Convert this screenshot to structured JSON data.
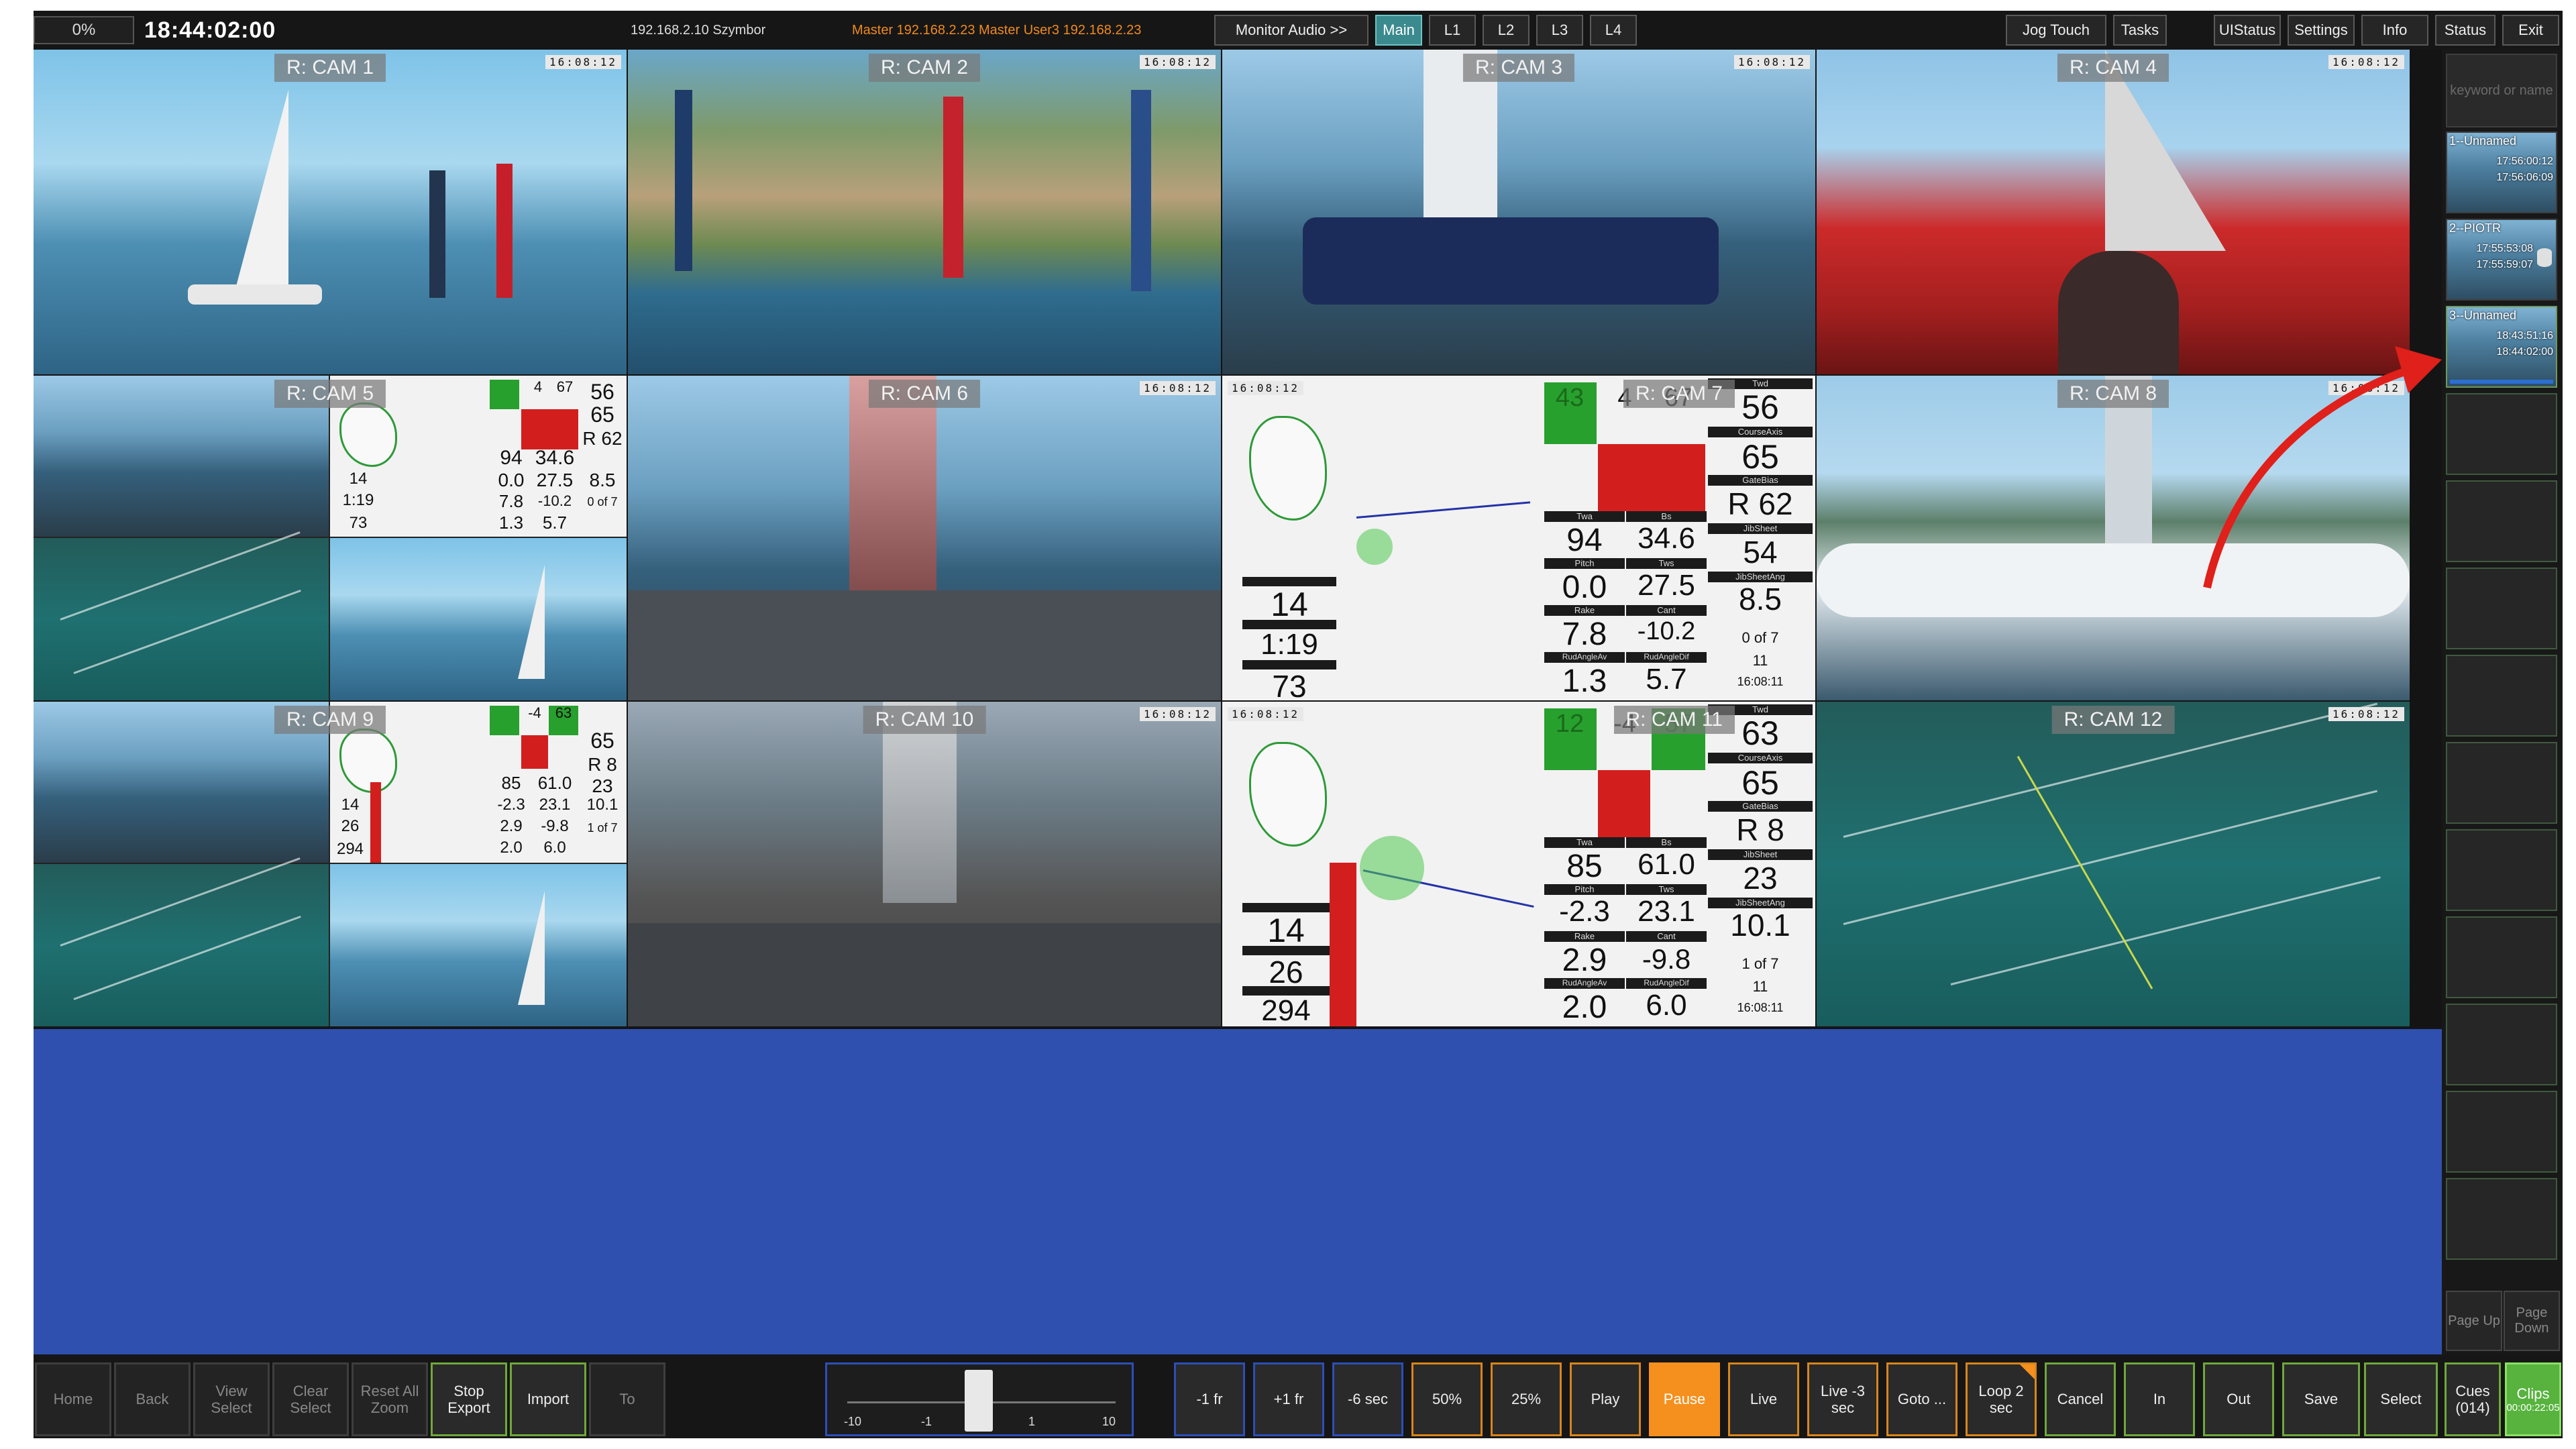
{
  "topbar": {
    "percent": "0%",
    "clock": "18:44:02:00",
    "ip_info": "192.168.2.10 Szymbor",
    "master_info": "Master 192.168.2.23   Master   User3   192.168.2.23",
    "buttons": {
      "monitor_audio": "Monitor Audio >>",
      "main": "Main",
      "l1": "L1",
      "l2": "L2",
      "l3": "L3",
      "l4": "L4",
      "jog_touch": "Jog Touch",
      "tasks": "Tasks",
      "uistatus": "UIStatus",
      "settings": "Settings",
      "info": "Info",
      "status": "Status",
      "exit": "Exit"
    }
  },
  "cams": [
    {
      "label": "R: CAM 1",
      "tc": "16:08:12"
    },
    {
      "label": "R: CAM 2",
      "tc": "16:08:12"
    },
    {
      "label": "R: CAM 3",
      "tc": "16:08:12"
    },
    {
      "label": "R: CAM 4",
      "tc": "16:08:12"
    },
    {
      "label": "R: CAM 5"
    },
    {
      "label": "R: CAM 6",
      "tc": "16:08:12"
    },
    {
      "label": "R: CAM 7",
      "tc": "16:08:12"
    },
    {
      "label": "R: CAM 8",
      "tc": "16:08:12"
    },
    {
      "label": "R: CAM 9"
    },
    {
      "label": "R: CAM 10",
      "tc": "16:08:12"
    },
    {
      "label": "R: CAM 11",
      "tc": "16:08:12"
    },
    {
      "label": "R: CAM 12",
      "tc": "16:08:12"
    }
  ],
  "telemetry_7": {
    "top": [
      "43",
      "4",
      "67"
    ],
    "twd_label": "Twd",
    "twd": "56",
    "courseaxis_label": "CourseAxis",
    "courseaxis": "65",
    "gatebias_label": "GateBias",
    "gatebias": "R 62",
    "jibsheet_label": "JibSheet",
    "jibsheet": "54",
    "jibsheetang_label": "JibSheetAng",
    "jibsheetang": "8.5",
    "twa_label": "Twa",
    "twa": "94",
    "bs_label": "Bs",
    "bs": "34.6",
    "pitch_label": "Pitch",
    "pitch": "0.0",
    "tws_label": "Tws",
    "tws": "27.5",
    "rake_label": "Rake",
    "rake": "7.8",
    "cant_label": "Cant",
    "cant": "-10.2",
    "rudangleav_label": "RudAngleAv",
    "rudangleav": "1.3",
    "rudangledif_label": "RudAngleDif",
    "rudangledif": "5.7",
    "count": "0 of 7",
    "small": "11",
    "time": "16:08:11",
    "left": [
      "14",
      "1:19",
      "73"
    ]
  },
  "telemetry_11": {
    "top": [
      "12",
      "-4",
      "57"
    ],
    "twd_label": "Twd",
    "twd": "63",
    "courseaxis_label": "CourseAxis",
    "courseaxis": "65",
    "gatebias_label": "GateBias",
    "gatebias": "R 8",
    "jibsheet_label": "JibSheet",
    "jibsheet": "23",
    "jibsheetang_label": "JibSheetAng",
    "jibsheetang": "10.1",
    "twa_label": "Twa",
    "twa": "85",
    "bs_label": "Bs",
    "bs": "61.0",
    "pitch_label": "Pitch",
    "pitch": "-2.3",
    "tws_label": "Tws",
    "tws": "23.1",
    "rake_label": "Rake",
    "rake": "2.9",
    "cant_label": "Cant",
    "cant": "-9.8",
    "rudangleav_label": "RudAngleAv",
    "rudangleav": "2.0",
    "rudangledif_label": "RudAngleDif",
    "rudangledif": "6.0",
    "count": "1 of 7",
    "small": "11",
    "time": "16:08:11",
    "left": [
      "14",
      "26",
      "294"
    ]
  },
  "telemetry_5": {
    "top": [
      "4",
      "67"
    ],
    "right": [
      "56",
      "65",
      "R 62"
    ],
    "twa": "94",
    "bs": "34.6",
    "pitch": "0.0",
    "tws": "27.5",
    "right2": "8.5",
    "rake": "7.8",
    "cant": "-10.2",
    "count": "0 of 7",
    "rud": "1.3",
    "dif": "5.7",
    "left": [
      "14",
      "1:19",
      "73"
    ]
  },
  "telemetry_9": {
    "top": [
      "-4",
      "63"
    ],
    "right": [
      "65",
      "R 8",
      "23"
    ],
    "twa": "85",
    "bs": "61.0",
    "pitch": "-2.3",
    "tws": "23.1",
    "right2": "10.1",
    "rake": "2.9",
    "cant": "-9.8",
    "count": "1 of 7",
    "rud": "2.0",
    "dif": "6.0",
    "left": [
      "14",
      "26",
      "294"
    ]
  },
  "right_panel": {
    "keyword_placeholder": "keyword or name",
    "clips": [
      {
        "name": "1--Unnamed",
        "in": "17:56:00:12",
        "out": "17:56:06:09"
      },
      {
        "name": "2--PIOTR",
        "in": "17:55:53:08",
        "out": "17:55:59:07"
      },
      {
        "name": "3--Unnamed",
        "in": "18:43:51:16",
        "out": "18:44:02:00"
      }
    ],
    "page_up": "Page Up",
    "page_down": "Page Down"
  },
  "bottom": {
    "home": "Home",
    "back": "Back",
    "view_select": "View Select",
    "clear_select": "Clear Select",
    "reset_all_zoom": "Reset All Zoom",
    "stop_export": "Stop Export",
    "import": "Import",
    "to": "To",
    "jog_ticks": [
      "-10",
      "-1",
      "1",
      "10"
    ],
    "minus_1fr": "-1 fr",
    "plus_1fr": "+1 fr",
    "minus_6sec": "-6 sec",
    "p50": "50%",
    "p25": "25%",
    "play": "Play",
    "pause": "Pause",
    "live": "Live",
    "live_minus_3": "Live -3 sec",
    "goto": "Goto ...",
    "loop": "Loop 2 sec",
    "cancel": "Cancel",
    "in": "In",
    "out": "Out",
    "save": "Save",
    "select": "Select",
    "cues": "Cues (014)",
    "clips": "Clips",
    "clips_time": "00:00:22:05"
  },
  "colors": {
    "accent_teal": "#3a8a8e",
    "pause_orange": "#f5901e",
    "clips_green": "#57b33e",
    "master_orange": "#f08a1c",
    "empty_area_blue": "#3050b0"
  }
}
